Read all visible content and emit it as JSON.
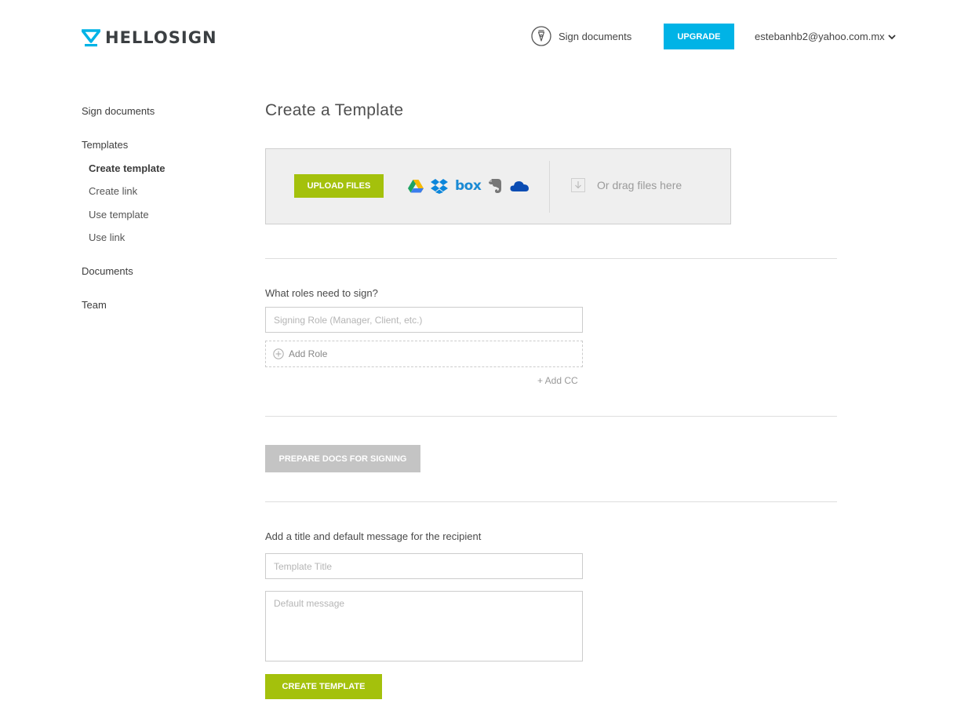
{
  "header": {
    "logo_text": "HELLOSIGN",
    "sign_documents": "Sign documents",
    "upgrade": "UPGRADE",
    "account_email": "estebanhb2@yahoo.com.mx"
  },
  "sidebar": {
    "sign_documents": "Sign documents",
    "templates": "Templates",
    "sub_items": [
      "Create template",
      "Create link",
      "Use template",
      "Use link"
    ],
    "documents": "Documents",
    "team": "Team"
  },
  "main": {
    "title": "Create a Template",
    "upload_button": "UPLOAD FILES",
    "cloud_icons": [
      "google-drive-icon",
      "dropbox-icon",
      "box-icon",
      "evernote-icon",
      "onedrive-icon"
    ],
    "box_label": "box",
    "drag_text": "Or drag files here",
    "roles_label": "What roles need to sign?",
    "role_placeholder": "Signing Role (Manager, Client, etc.)",
    "add_role": "Add Role",
    "add_cc": "+ Add CC",
    "prepare_button": "PREPARE DOCS FOR SIGNING",
    "message_label": "Add a title and default message for the recipient",
    "title_placeholder": "Template Title",
    "message_placeholder": "Default message",
    "create_button": "CREATE TEMPLATE"
  },
  "colors": {
    "brand_blue": "#00b3e6",
    "action_green": "#a4c10c",
    "disabled_gray": "#c4c4c4"
  }
}
